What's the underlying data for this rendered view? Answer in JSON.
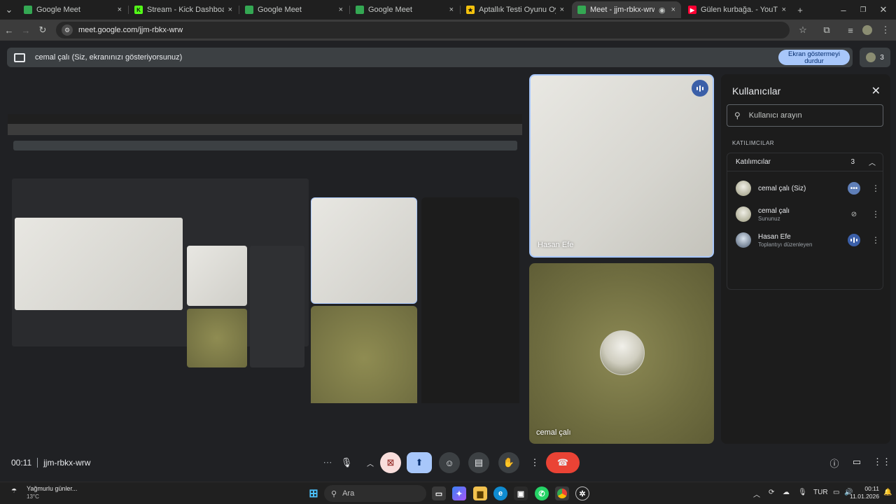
{
  "browser": {
    "tabs": [
      {
        "title": "Google Meet",
        "icon": "meet-icon",
        "active": false
      },
      {
        "title": "Stream - Kick Dashboard",
        "icon": "kick-icon",
        "active": false
      },
      {
        "title": "Google Meet",
        "icon": "meet-icon",
        "active": false
      },
      {
        "title": "Google Meet",
        "icon": "meet-icon",
        "active": false
      },
      {
        "title": "Aptallık Testi Oyunu Oyna",
        "icon": "trophy-icon",
        "active": false
      },
      {
        "title": "Meet - jjm-rbkx-wrw",
        "icon": "meet-icon",
        "active": true
      },
      {
        "title": "Gülen kurbağa. - YouTube",
        "icon": "youtube-icon",
        "active": false
      }
    ],
    "url": "meet.google.com/jjm-rbkx-wrw",
    "close_symbol": "×",
    "new_tab_symbol": "+"
  },
  "banner": {
    "text": "cemal çalı (Siz, ekranınızı gösteriyorsunuz)",
    "stop_button_line1": "Ekran göstermeyi",
    "stop_button_line2": "durdur",
    "participant_count": "3"
  },
  "tiles": {
    "hasan": {
      "name": "Hasan Efe"
    },
    "cemal": {
      "name": "cemal çalı"
    }
  },
  "people_panel": {
    "title": "Kullanıcılar",
    "search_placeholder": "Kullanıcı arayın",
    "section_label": "KATILIMCILAR",
    "group_label": "Katılımcılar",
    "group_count": "3",
    "participants": [
      {
        "name": "cemal çalı (Siz)",
        "role": "",
        "state": "more-options"
      },
      {
        "name": "cemal çalı",
        "role": "Sununuz",
        "state": "muted"
      },
      {
        "name": "Hasan Efe",
        "role": "Toplantıyı düzenleyen",
        "state": "speaking"
      }
    ]
  },
  "meeting": {
    "time": "00:11",
    "code": "jjm-rbkx-wrw"
  },
  "taskbar": {
    "weather_title": "Yağmurlu günler...",
    "weather_temp": "13°C",
    "search_label": "Ara",
    "lang": "TUR",
    "clock_time": "00:11",
    "clock_date": "11.01.2026"
  },
  "colors": {
    "accent": "#a8c7fa",
    "end_call": "#ea4335",
    "panel_bg": "#1c1c1c"
  }
}
